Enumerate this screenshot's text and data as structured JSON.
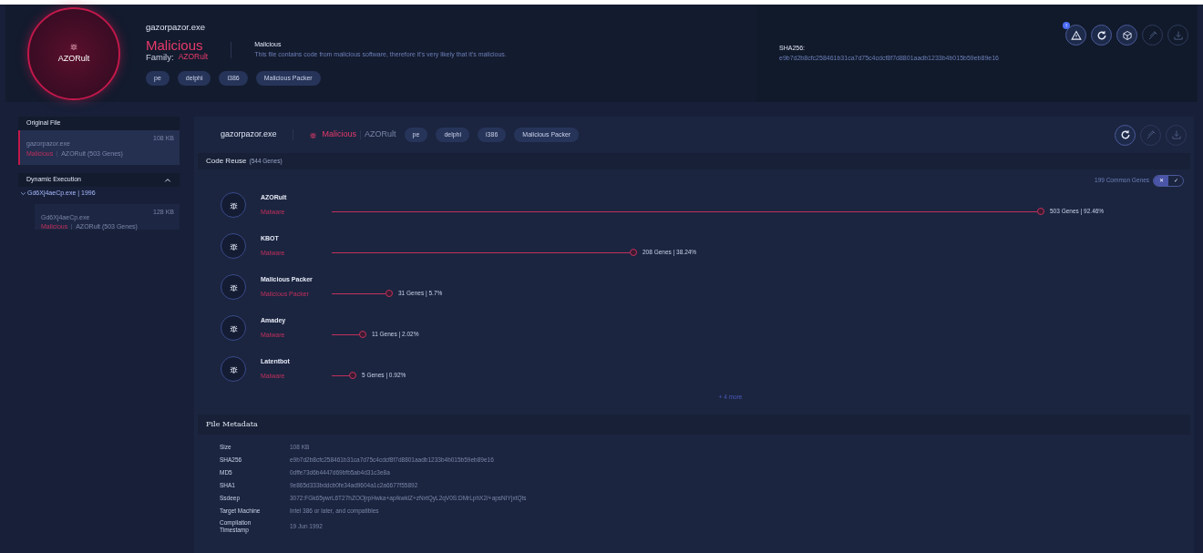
{
  "header": {
    "verdict_label": "AZORult",
    "file_name": "gazorpazor.exe",
    "verdict": "Malicious",
    "family_label": "Family:",
    "family": "AZORult",
    "tags": [
      "pe",
      "delphi",
      "i386",
      "Malicious Packer"
    ],
    "verdict_title": "Malicious",
    "verdict_description": "This file contains code from malicious software, therefore it's very likely that it's malicious.",
    "sha256_label": "SHA256:",
    "sha256": "e9b7d2b8cfc258461b31ca7d75c4cdcf8f7d8801aadb1233b4b015b59eb89e16",
    "notification_badge": "!",
    "actions": [
      {
        "kind": "warning",
        "disabled": false
      },
      {
        "kind": "refresh",
        "disabled": false
      },
      {
        "kind": "cube",
        "disabled": false
      },
      {
        "kind": "pin",
        "disabled": true
      },
      {
        "kind": "download",
        "disabled": true
      }
    ]
  },
  "sidebar": {
    "original_title": "Original File",
    "original_file": {
      "name": "gazorpazor.exe",
      "size": "108 KB",
      "verdict": "Malicious",
      "family": "AZORult (503 Genes)",
      "selected": true
    },
    "dynamic_title": "Dynamic Execution",
    "dynamic_expanded": true,
    "process": {
      "label": "Gd6Xj4aeCp.exe | 1996",
      "expanded": true,
      "children": [
        {
          "name": "Gd6Xj4aeCp.exe",
          "size": "128 KB",
          "verdict": "Malicious",
          "family": "AZORult (503 Genes)",
          "selected": false
        }
      ]
    }
  },
  "main": {
    "file_name": "gazorpazor.exe",
    "verdict": "Malicious",
    "family": "AZORult",
    "tags": [
      "pe",
      "delphi",
      "i386",
      "Malicious Packer"
    ],
    "actions": [
      {
        "kind": "refresh",
        "disabled": false
      },
      {
        "kind": "pin",
        "disabled": true
      },
      {
        "kind": "download",
        "disabled": true
      }
    ],
    "code_reuse": {
      "title": "Code Reuse",
      "count": "(544 Genes)",
      "common_genes": "199 Common Genes",
      "toggle": [
        {
          "label": "✕",
          "selected": true
        },
        {
          "label": "✓",
          "selected": false
        }
      ],
      "genes": [
        {
          "name": "AZORult",
          "category": "Malware",
          "reading": "503 Genes | 92.46%"
        },
        {
          "name": "KBOT",
          "category": "Malware",
          "reading": "208 Genes | 38.24%"
        },
        {
          "name": "Malicious Packer",
          "category": "Malicious Packer",
          "reading": "31 Genes | 5.7%"
        },
        {
          "name": "Amadey",
          "category": "Malware",
          "reading": "11 Genes | 2.02%"
        },
        {
          "name": "Latentbot",
          "category": "Malware",
          "reading": "5 Genes | 0.92%"
        }
      ],
      "more": "+ 4 more"
    },
    "metadata": {
      "title": "File Metadata",
      "rows": [
        {
          "label": "Size",
          "value": "108 KB"
        },
        {
          "label": "SHA256",
          "value": "e9b7d2b8cfc258461b31ca7d75c4cdcf8f7d8801aadb1233b4b015b59eb89e16"
        },
        {
          "label": "MD5",
          "value": "0dffe73d6b4447d69bfb5ab4d31c3e8a"
        },
        {
          "label": "SHA1",
          "value": "9e865d333bddcb0fe34ad9604a1c2a6677f55892"
        },
        {
          "label": "Ssdeep",
          "value": "3072:FGk65ywrL6T27hZOOjrpHwka+ap/kwklZ+zNxtQyL2qV0S:DMrLphX2/+apsNIYjxtQts"
        },
        {
          "label": "Target Machine",
          "value": "Intel 386 or later, and compatibles"
        },
        {
          "label": "Compilation Timestamp",
          "value": "19 Jun 1992"
        }
      ]
    }
  }
}
